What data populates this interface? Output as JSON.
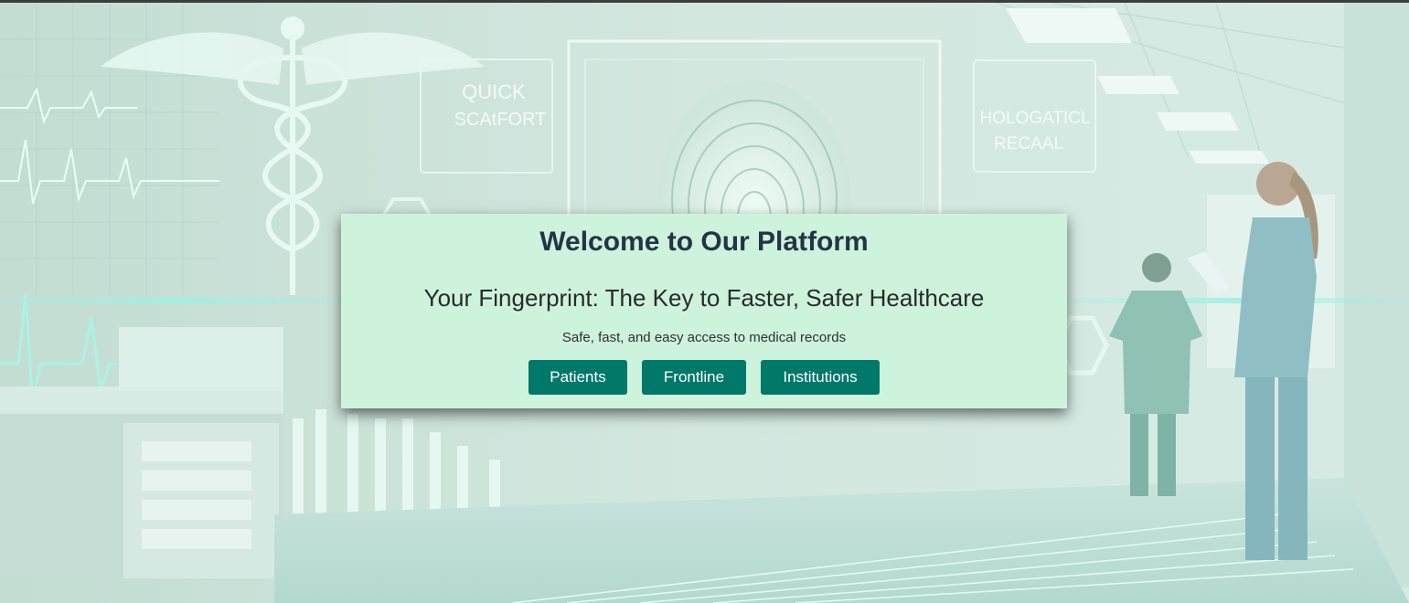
{
  "hero": {
    "title": "Welcome to Our Platform",
    "tagline": "Your Fingerprint: The Key to Faster, Safer Healthcare",
    "subtitle": "Safe, fast, and easy access to medical records",
    "buttons": {
      "patients": "Patients",
      "frontline": "Frontline",
      "institutions": "Institutions"
    }
  },
  "background": {
    "sign_left": "QUICK SCAtFORT",
    "sign_right": "HOLOGATICL RECAAL",
    "description": "hospital corridor with medical caduceus, fingerprint hologram and nurses"
  },
  "colors": {
    "card_bg": "#cdf3dc",
    "title_color": "#243447",
    "button_bg": "#00786a",
    "button_text": "#ffffff",
    "scene_tint": "#cfe6dc",
    "glow": "#9ff0e4"
  }
}
